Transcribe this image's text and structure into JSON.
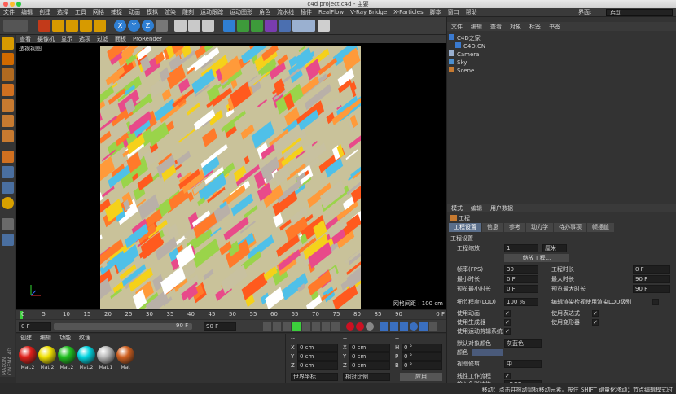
{
  "window": {
    "title": "c4d project.c4d - 主要"
  },
  "menu": [
    "文件",
    "编辑",
    "创建",
    "选择",
    "工具",
    "网格",
    "捕捉",
    "动画",
    "模拟",
    "渲染",
    "雕刻",
    "运动跟踪",
    "运动图形",
    "角色",
    "流水线",
    "插件",
    "RealFlow",
    "V-Ray Bridge",
    "X-Particles",
    "脚本",
    "窗口",
    "帮助"
  ],
  "layout": {
    "label": "界面:",
    "value": "启动"
  },
  "toolbar": {
    "axis_x": "X",
    "axis_y": "Y",
    "axis_z": "Z"
  },
  "viewport": {
    "menu": [
      "查看",
      "摄像机",
      "显示",
      "选项",
      "过滤",
      "面板",
      "ProRender"
    ],
    "label": "透视视图",
    "grid_info": "网格间距 : 100 cm"
  },
  "timeline": {
    "ticks": [
      "0",
      "5",
      "10",
      "15",
      "20",
      "25",
      "30",
      "35",
      "40",
      "45",
      "50",
      "55",
      "60",
      "65",
      "70",
      "75",
      "80",
      "85",
      "90"
    ],
    "current_frame": "0 F",
    "start": "0 F",
    "end": "90 F",
    "end2": "90 F",
    "frame_readout": "0 F"
  },
  "materials": {
    "menu": [
      "创建",
      "编辑",
      "功能",
      "纹理"
    ],
    "items": [
      {
        "label": "Mat.2",
        "color": "#e0201a"
      },
      {
        "label": "Mat.2",
        "color": "#f0e000"
      },
      {
        "label": "Mat.2",
        "color": "#20c020"
      },
      {
        "label": "Mat.2",
        "color": "#00d4e0"
      },
      {
        "label": "Mat.1",
        "color": "#b8b8b8"
      },
      {
        "label": "Mat",
        "color": "#d06020"
      }
    ]
  },
  "coords": {
    "header": [
      "--",
      "--",
      "--"
    ],
    "rows": [
      {
        "a": "X",
        "av": "0 cm",
        "b": "X",
        "bv": "0 cm",
        "c": "H",
        "cv": "0 °"
      },
      {
        "a": "Y",
        "av": "0 cm",
        "b": "Y",
        "bv": "0 cm",
        "c": "P",
        "cv": "0 °"
      },
      {
        "a": "Z",
        "av": "0 cm",
        "b": "Z",
        "bv": "0 cm",
        "c": "B",
        "cv": "0 °"
      }
    ],
    "world": "世界坐标",
    "scale": "相对比例",
    "apply": "应用"
  },
  "objects": {
    "menu": [
      "文件",
      "编辑",
      "查看",
      "对象",
      "标签",
      "书签"
    ],
    "items": [
      {
        "name": "C4D之家",
        "indent": 0
      },
      {
        "name": "C4D.CN",
        "indent": 1
      },
      {
        "name": "Camera",
        "indent": 0
      },
      {
        "name": "Sky",
        "indent": 0
      },
      {
        "name": "Scene",
        "indent": 0
      }
    ]
  },
  "attributes": {
    "menu": [
      "模式",
      "编辑",
      "用户数据"
    ],
    "title": "工程",
    "tabs": [
      "工程设置",
      "信息",
      "参考",
      "动力学",
      "待办事项",
      "帧插值"
    ],
    "section": "工程设置",
    "scale_label": "工程缩放",
    "scale_value": "1",
    "scale_unit": "厘米",
    "scale_button": "缩放工程...",
    "fps_label": "帧率(FPS)",
    "fps_value": "30",
    "duration_label": "工程时长",
    "duration_value": "0 F",
    "min_label": "最小时长",
    "min_value": "0 F",
    "max_label": "最大时长",
    "max_value": "90 F",
    "pmin_label": "预览最小时长",
    "pmin_value": "0 F",
    "pmax_label": "预览最大时长",
    "pmax_value": "90 F",
    "lod_label": "细节程度(LOD)",
    "lod_value": "100 %",
    "lod_render": "编辑渲染检视使用渲染LOD级别",
    "anim_label": "使用动画",
    "expr_label": "使用表达式",
    "gen_label": "使用生成器",
    "deform_label": "使用变形器",
    "mograph_label": "使用运动剪辑系统",
    "defcolor_label": "默认对象颜色",
    "defcolor_value": "灰蓝色",
    "color_label": "颜色",
    "viewclip_label": "视图修剪",
    "viewclip_value": "中",
    "linear_label": "线性工作流程",
    "input_label": "输入色彩特性",
    "input_value": "sRGB"
  },
  "status": {
    "text": "移动：点击并拖动鼠标移动元素。按住 SHIFT 键量化移动；节点编辑模式时"
  },
  "brand": {
    "text": "MAXON CINEMA 4D"
  }
}
